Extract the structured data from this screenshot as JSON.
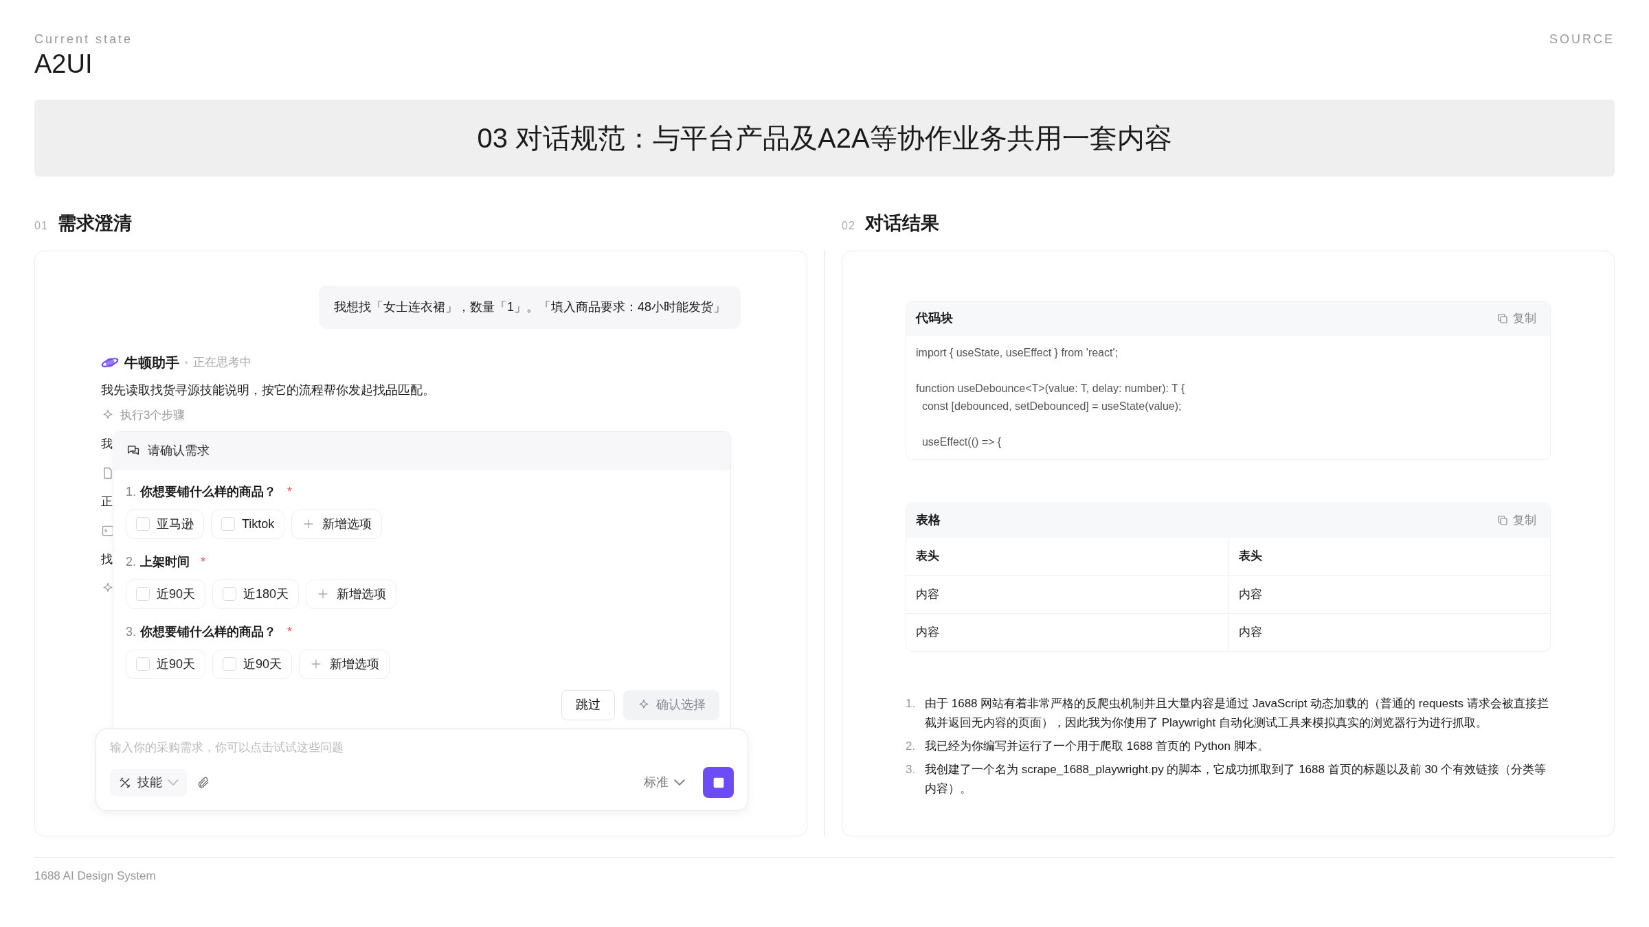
{
  "header": {
    "eyebrow": "Current state",
    "title": "A2UI",
    "source": "SOURCE"
  },
  "banner": {
    "title": "03 对话规范：与平台产品及A2A等协作业务共用一套内容"
  },
  "sections": [
    {
      "index": "01",
      "title": "需求澄清"
    },
    {
      "index": "02",
      "title": "对话结果"
    }
  ],
  "chat": {
    "user_message": "我想找「女士连衣裙」，数量「1」。「填入商品要求：48小时能发货」",
    "assistant": {
      "name": "牛顿助手",
      "status": "正在思考中",
      "message": "我先读取找货寻源技能说明，按它的流程帮你发起找品匹配。"
    },
    "steps": [
      {
        "kind": "step",
        "label": "执行3个步骤"
      },
      {
        "kind": "text",
        "text": "我"
      },
      {
        "kind": "file"
      },
      {
        "kind": "text",
        "text": "正"
      },
      {
        "kind": "terminal"
      },
      {
        "kind": "text",
        "text": "找"
      },
      {
        "kind": "step"
      }
    ],
    "confirm_card": {
      "title": "请确认需求",
      "questions": [
        {
          "number": "1.",
          "text": "你想要铺什么样的商品？",
          "required_mark": "*",
          "options": [
            {
              "kind": "checkbox",
              "label": "亚马逊",
              "checked": false
            },
            {
              "kind": "checkbox",
              "label": "Tiktok",
              "checked": false
            },
            {
              "kind": "add",
              "label": "新增选项"
            }
          ]
        },
        {
          "number": "2.",
          "text": "上架时间",
          "required_mark": "*",
          "options": [
            {
              "kind": "checkbox",
              "label": "近90天",
              "checked": false
            },
            {
              "kind": "checkbox",
              "label": "近180天",
              "checked": false
            },
            {
              "kind": "add",
              "label": "新增选项"
            }
          ]
        },
        {
          "number": "3.",
          "text": "你想要铺什么样的商品？",
          "required_mark": "*",
          "options": [
            {
              "kind": "checkbox",
              "label": "近90天",
              "checked": false
            },
            {
              "kind": "checkbox",
              "label": "近90天",
              "checked": false
            },
            {
              "kind": "add",
              "label": "新增选项"
            }
          ]
        }
      ],
      "buttons": [
        {
          "kind": "skip",
          "label": "跳过",
          "disabled": false
        },
        {
          "kind": "confirm",
          "label": "确认选择",
          "disabled": true
        }
      ]
    },
    "input": {
      "placeholder": "输入你的采购需求，你可以点击试试这些问题",
      "skill_label": "技能",
      "mode_label": "标准"
    }
  },
  "result": {
    "code_block": {
      "title": "代码块",
      "copy_label": "复制",
      "paragraphs": [
        [
          "import { useState, useEffect } from 'react';"
        ],
        [
          "function useDebounce<T>(value: T, delay: number): T {",
          "  const [debounced, setDebounced] = useState(value);"
        ],
        [
          "  useEffect(() => {"
        ]
      ]
    },
    "table": {
      "title": "表格",
      "copy_label": "复制",
      "columns": [
        "表头",
        "表头"
      ],
      "rows": [
        [
          "内容",
          "内容"
        ],
        [
          "内容",
          "内容"
        ]
      ]
    },
    "list": [
      {
        "number": "1.",
        "text": "由于 1688 网站有着非常严格的反爬虫机制并且大量内容是通过 JavaScript 动态加载的（普通的 requests 请求会被直接拦截并返回无内容的页面），因此我为你使用了 Playwright 自动化测试工具来模拟真实的浏览器行为进行抓取。"
      },
      {
        "number": "2.",
        "text": "我已经为你编写并运行了一个用于爬取 1688 首页的 Python 脚本。"
      },
      {
        "number": "3.",
        "text": "我创建了一个名为 scrape_1688_playwright.py 的脚本，它成功抓取到了 1688 首页的标题以及前 30 个有效链接（分类等内容）。"
      }
    ]
  },
  "footer": "1688 AI Design System"
}
